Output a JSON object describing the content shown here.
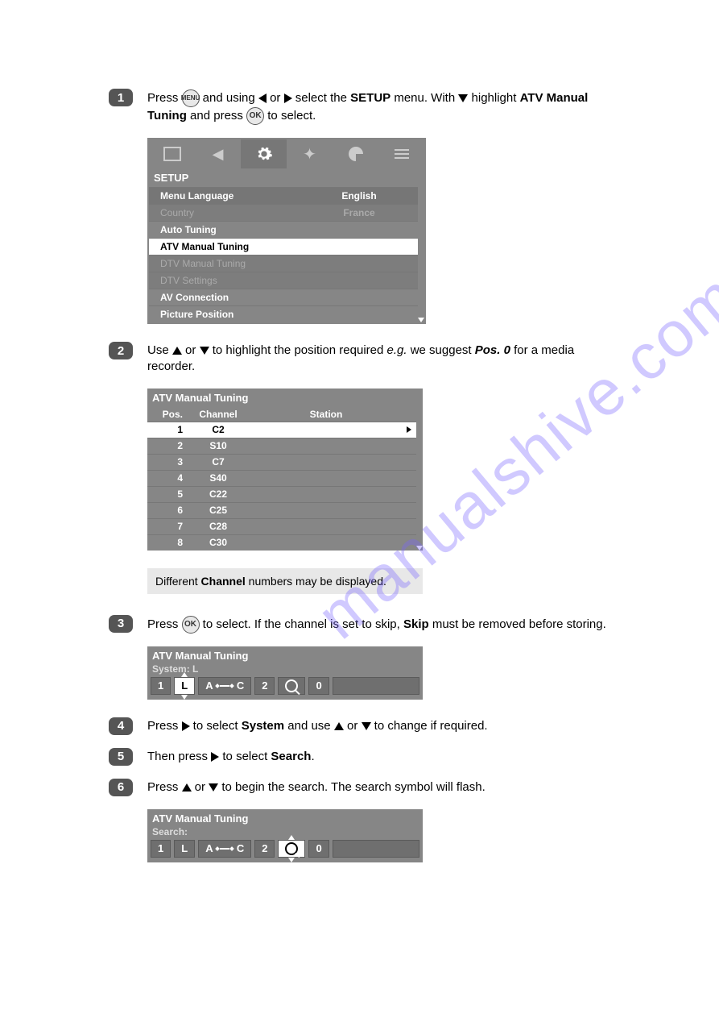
{
  "watermark": "manualshive.com",
  "steps": {
    "s1": {
      "num": "1",
      "t1": "Press ",
      "menu_btn": "MENU",
      "t2": " and using ",
      "t3": " or ",
      "t4": " select the ",
      "b1": "SETUP",
      "t5": " menu. With ",
      "t6": " highlight ",
      "b2": "ATV Manual Tuning",
      "t7": " and press ",
      "ok_btn": "OK",
      "t8": " to select."
    },
    "s2": {
      "num": "2",
      "t1": "Use ",
      "t2": " or ",
      "t3": " to highlight the position required ",
      "i1": "e.g.",
      "t4": " we suggest ",
      "bi1": "Pos. 0",
      "t5": " for a media recorder."
    },
    "s3": {
      "num": "3",
      "t1": "Press ",
      "ok_btn": "OK",
      "t2": " to select. If the channel is set to skip, ",
      "b1": "Skip",
      "t3": " must be removed before storing."
    },
    "s4": {
      "num": "4",
      "t1": "Press ",
      "t2": " to select ",
      "b1": "System",
      "t3": " and use ",
      "t4": " or ",
      "t5": " to change if required."
    },
    "s5": {
      "num": "5",
      "t1": "Then press ",
      "t2": " to select ",
      "b1": "Search",
      "t3": "."
    },
    "s6": {
      "num": "6",
      "t1": "Press ",
      "t2": " or ",
      "t3": " to begin the search. The search symbol will flash."
    }
  },
  "setup_menu": {
    "title": "SETUP",
    "rows": {
      "r0": {
        "label": "Menu Language",
        "value": "English"
      },
      "r1": {
        "label": "Country",
        "value": "France"
      },
      "r2": {
        "label": "Auto Tuning",
        "value": ""
      },
      "r3": {
        "label": "ATV Manual Tuning",
        "value": ""
      },
      "r4": {
        "label": "DTV Manual Tuning",
        "value": ""
      },
      "r5": {
        "label": "DTV Settings",
        "value": ""
      },
      "r6": {
        "label": "AV Connection",
        "value": ""
      },
      "r7": {
        "label": "Picture Position",
        "value": ""
      }
    }
  },
  "chan_table": {
    "title": "ATV Manual Tuning",
    "head": {
      "pos": "Pos.",
      "chan": "Channel",
      "stn": "Station"
    },
    "rows": {
      "r1": {
        "pos": "1",
        "chan": "C2"
      },
      "r2": {
        "pos": "2",
        "chan": "S10"
      },
      "r3": {
        "pos": "3",
        "chan": "C7"
      },
      "r4": {
        "pos": "4",
        "chan": "S40"
      },
      "r5": {
        "pos": "5",
        "chan": "C22"
      },
      "r6": {
        "pos": "6",
        "chan": "C25"
      },
      "r7": {
        "pos": "7",
        "chan": "C28"
      },
      "r8": {
        "pos": "8",
        "chan": "C30"
      }
    }
  },
  "note": {
    "t1": "Different ",
    "b1": "Channel",
    "t2": " numbers may be displayed."
  },
  "tune1": {
    "title": "ATV Manual Tuning",
    "sub": "System: L",
    "c1": "1",
    "c2": "L",
    "c3": "A",
    "c4": "C",
    "c5": "2",
    "c6": "0"
  },
  "tune2": {
    "title": "ATV Manual Tuning",
    "sub": "Search:",
    "c1": "1",
    "c2": "L",
    "c3": "A",
    "c4": "C",
    "c5": "2",
    "c6": "0"
  }
}
